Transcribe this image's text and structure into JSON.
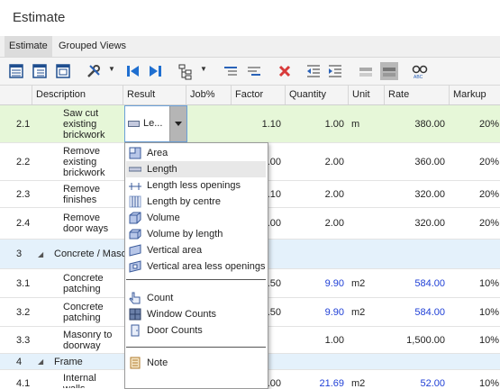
{
  "window": {
    "title": "Estimate"
  },
  "tabs": [
    {
      "label": "Estimate",
      "active": true
    },
    {
      "label": "Grouped Views",
      "active": false
    }
  ],
  "toolbar": {
    "icons": [
      "grid-view-icon",
      "list-view-icon",
      "report-view-icon",
      "tools-icon",
      "prev-icon",
      "next-icon",
      "hierarchy-icon",
      "indent-icon",
      "outdent-icon",
      "delete-icon",
      "decrease-indent-icon",
      "increase-indent-icon",
      "collapse-icon",
      "expand-icon",
      "spell-check-icon"
    ]
  },
  "columns": [
    "Description",
    "Result",
    "Job%",
    "Factor",
    "Quantity",
    "Unit",
    "Rate",
    "Markup"
  ],
  "rows": [
    {
      "num": "2.1",
      "desc": "Saw cut existing brickwork",
      "factor": "1.10",
      "qty": "1.00",
      "unit": "m",
      "rate": "380.00",
      "markup": "20%"
    },
    {
      "num": "2.2",
      "desc": "Remove existing brickwork",
      "factor": ".00",
      "qty": "2.00",
      "unit": "",
      "rate": "360.00",
      "markup": "20%"
    },
    {
      "num": "2.3",
      "desc": "Remove finishes",
      "factor": ".10",
      "qty": "2.00",
      "unit": "",
      "rate": "320.00",
      "markup": "20%"
    },
    {
      "num": "2.4",
      "desc": "Remove door ways",
      "factor": ".00",
      "qty": "2.00",
      "unit": "",
      "rate": "320.00",
      "markup": "20%"
    },
    {
      "num": "3",
      "desc": "Concrete / Masonary"
    },
    {
      "num": "3.1",
      "desc": "Concrete patching",
      "factor": ".50",
      "qty": "9.90",
      "unit": "m2",
      "rate": "584.00",
      "markup": "10%"
    },
    {
      "num": "3.2",
      "desc": "Concrete patching",
      "factor": ".50",
      "qty": "9.90",
      "unit": "m2",
      "rate": "584.00",
      "markup": "10%"
    },
    {
      "num": "3.3",
      "desc": "Masonry to doorway",
      "factor": "",
      "qty": "1.00",
      "unit": "",
      "rate": "1,500.00",
      "markup": "10%"
    },
    {
      "num": "4",
      "desc": "Frame"
    },
    {
      "num": "4.1",
      "desc": "Internal walls",
      "factor": ".00",
      "qty": "21.69",
      "unit": "m2",
      "rate": "52.00",
      "markup": "10%"
    }
  ],
  "result_editor": {
    "value": "Le..."
  },
  "result_menu": {
    "items": [
      {
        "label": "Area",
        "icon": "area-icon"
      },
      {
        "label": "Length",
        "icon": "length-icon",
        "highlighted": true
      },
      {
        "label": "Length less openings",
        "icon": "length-less-openings-icon"
      },
      {
        "label": "Length by centre",
        "icon": "length-by-centre-icon"
      },
      {
        "label": "Volume",
        "icon": "volume-icon"
      },
      {
        "label": "Volume by length",
        "icon": "volume-by-length-icon"
      },
      {
        "label": "Vertical area",
        "icon": "vertical-area-icon"
      },
      {
        "label": "Vertical area less openings",
        "icon": "vertical-area-less-openings-icon"
      },
      {
        "label": "Count",
        "icon": "count-icon"
      },
      {
        "label": "Window Counts",
        "icon": "window-counts-icon"
      },
      {
        "label": "Door Counts",
        "icon": "door-counts-icon"
      },
      {
        "label": "Note",
        "icon": "note-icon"
      }
    ]
  }
}
